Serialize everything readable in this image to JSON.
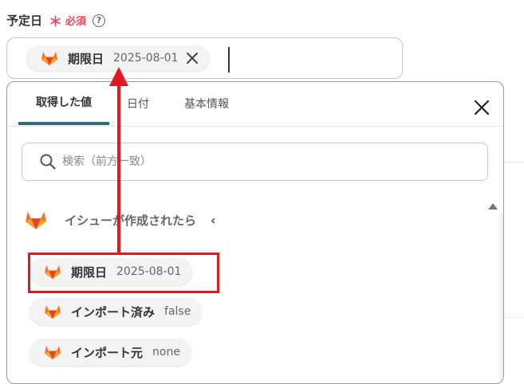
{
  "field": {
    "label": "予定日",
    "required_mark": "＊",
    "required_text": "必須",
    "help_icon": "?",
    "chip": {
      "icon": "gitlab-icon",
      "label": "期限日",
      "value": "2025-08-01"
    }
  },
  "dropdown": {
    "tabs": [
      "取得した値",
      "日付",
      "基本情報"
    ],
    "active_tab": 0,
    "search_placeholder": "検索（前方一致）",
    "section": {
      "icon": "gitlab-icon",
      "title": "イシューが作成されたら",
      "chevron": "‹"
    },
    "items": [
      {
        "icon": "gitlab-icon",
        "label": "期限日",
        "value": "2025-08-01"
      },
      {
        "icon": "gitlab-icon",
        "label": "インポート済み",
        "value": "false"
      },
      {
        "icon": "gitlab-icon",
        "label": "インポート元",
        "value": "none"
      }
    ]
  },
  "colors": {
    "required": "#e8475a",
    "active_tab_underline": "#2b6d7a",
    "annotation": "#e11a22",
    "gitlab_orange": "#fc6d26",
    "gitlab_dark": "#e24329",
    "gitlab_light": "#fca326"
  }
}
